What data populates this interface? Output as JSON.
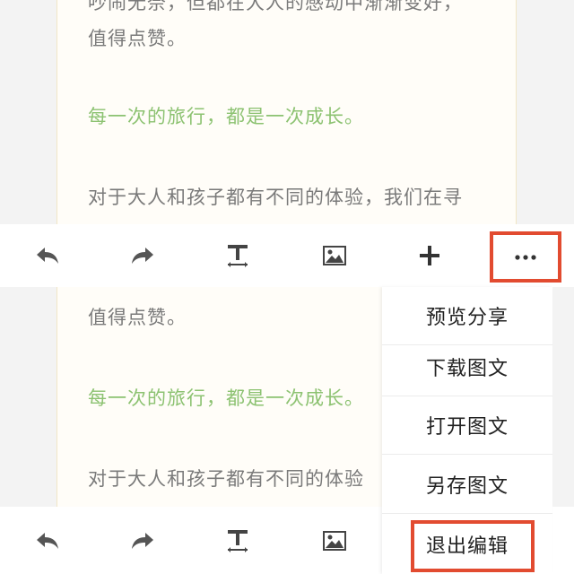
{
  "document": {
    "top_partial_line": "吵闹无奈，但都在大人的感动中渐渐变好，",
    "line_praise": "值得点赞。",
    "line_growth": "每一次的旅行，都是一次成长。",
    "line_experience_full": "对于大人和孩子都有不同的体验，我们在寻",
    "line_experience_cut": "对于大人和孩子都有不同的体验"
  },
  "toolbar": {
    "icons": [
      "undo-icon",
      "redo-icon",
      "text-format-icon",
      "image-icon",
      "add-icon",
      "more-icon"
    ]
  },
  "menu": {
    "items": [
      "预览分享",
      "下载图文",
      "打开图文",
      "另存图文",
      "退出编辑"
    ]
  },
  "colors": {
    "highlight": "#e24b30",
    "green_text": "#8cc271",
    "body_text": "#7a7a7a",
    "icon": "#555555"
  }
}
